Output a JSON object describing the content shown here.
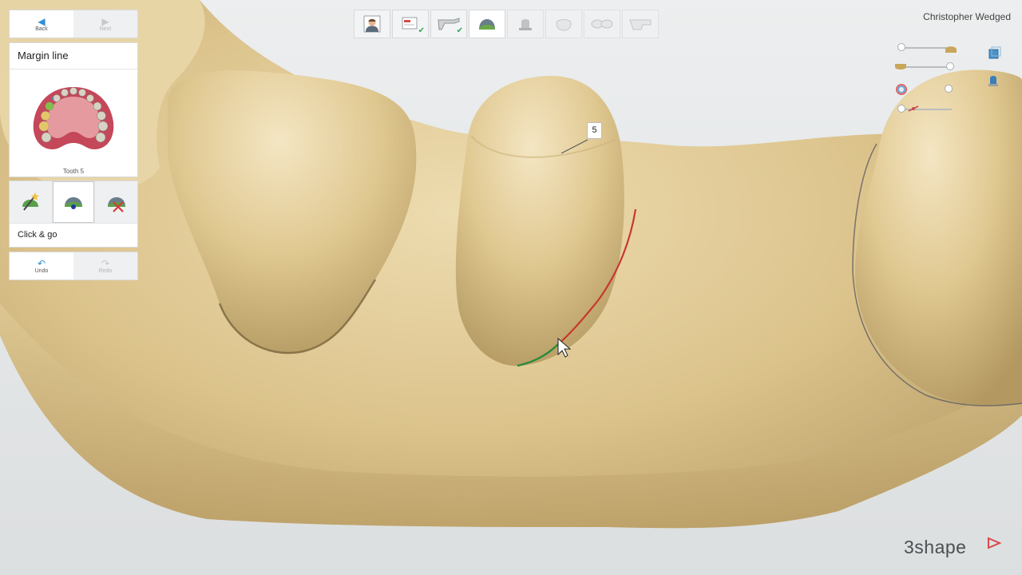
{
  "app": {
    "user_name": "Christopher Wedged",
    "brand": "3shape"
  },
  "nav": {
    "back_label": "Back",
    "next_label": "Next"
  },
  "step": {
    "title": "Margin line",
    "tooth_label": "Tooth 5"
  },
  "tools": {
    "active_index": 1,
    "items": [
      {
        "name": "auto-detect-tool"
      },
      {
        "name": "click-and-go-tool"
      },
      {
        "name": "delete-margin-tool"
      }
    ],
    "mode_label": "Click & go"
  },
  "history": {
    "undo_label": "Undo",
    "redo_label": "Redo"
  },
  "workflow": {
    "steps": [
      {
        "icon": "patient-photo-icon",
        "state": "default"
      },
      {
        "icon": "order-form-icon",
        "state": "done"
      },
      {
        "icon": "scan-tool-icon",
        "state": "done"
      },
      {
        "icon": "margin-line-icon",
        "state": "active"
      },
      {
        "icon": "die-icon",
        "state": "pending"
      },
      {
        "icon": "crown-icon",
        "state": "pending"
      },
      {
        "icon": "bridge-icon",
        "state": "pending"
      },
      {
        "icon": "export-icon",
        "state": "pending"
      }
    ]
  },
  "viewport": {
    "tooth_marker": "5"
  },
  "colors": {
    "model": "#e7d2a2",
    "accent": "#2f8ed6",
    "margin_red": "#c7382c",
    "margin_green": "#2c8a3a"
  }
}
